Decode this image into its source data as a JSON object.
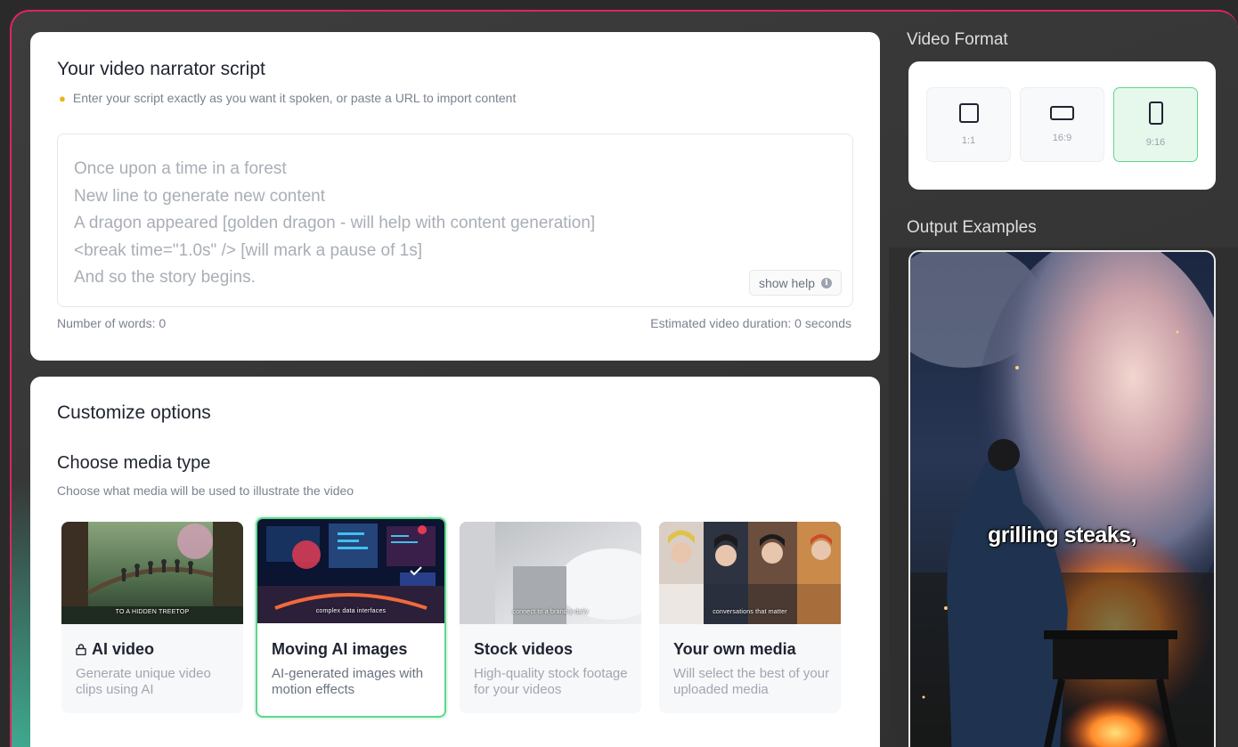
{
  "script": {
    "title": "Your video narrator script",
    "hint_icon": "lightbulb-icon",
    "hint": "Enter your script exactly as you want it spoken, or paste a URL to import content",
    "placeholder_lines": [
      "Once upon a time in a forest",
      "New line to generate new content",
      "A dragon appeared  [golden dragon - will help with content generation]",
      "<break time=\"1.0s\" />  [will mark a pause of 1s]",
      "And so the story begins."
    ],
    "show_help": "show help",
    "word_count": "Number of words: 0",
    "duration": "Estimated video duration: 0 seconds"
  },
  "options": {
    "title": "Customize options",
    "media_title": "Choose media type",
    "media_subtitle": "Choose what media will be used to illustrate the video",
    "media_types": [
      {
        "title": "AI video",
        "desc": "Generate unique video clips using AI",
        "thumb_caption": "TO A HIDDEN TREETOP",
        "locked": true,
        "selected": false
      },
      {
        "title": "Moving AI images",
        "desc": "AI-generated images with motion effects",
        "thumb_caption": "complex data interfaces",
        "locked": false,
        "selected": true
      },
      {
        "title": "Stock videos",
        "desc": "High-quality stock footage for your videos",
        "thumb_caption": "connect to a brand-y daily",
        "locked": false,
        "selected": false
      },
      {
        "title": "Your own media",
        "desc": "Will select the best of your uploaded media",
        "thumb_caption": "conversations that matter",
        "locked": false,
        "selected": false
      }
    ]
  },
  "format": {
    "label": "Video Format",
    "options": [
      {
        "label": "1:1",
        "icon": "square-icon",
        "selected": false
      },
      {
        "label": "16:9",
        "icon": "landscape-icon",
        "selected": false
      },
      {
        "label": "9:16",
        "icon": "portrait-icon",
        "selected": true
      }
    ]
  },
  "examples": {
    "label": "Output Examples",
    "caption": "grilling steaks,"
  },
  "colors": {
    "accent_green": "#5ed78b",
    "frame_border": "#e0245e",
    "caption_highlight": "#e5391f"
  }
}
